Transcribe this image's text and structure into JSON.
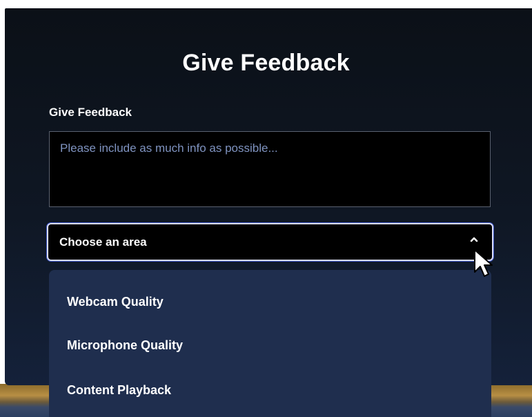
{
  "modal": {
    "title": "Give Feedback"
  },
  "feedback": {
    "label": "Give Feedback",
    "placeholder": "Please include as much info as possible..."
  },
  "area_select": {
    "selected": "Choose an area",
    "options": [
      {
        "label": "Webcam Quality"
      },
      {
        "label": "Microphone Quality"
      },
      {
        "label": "Content Playback"
      }
    ]
  },
  "colors": {
    "modal_bg": "#0b1017",
    "dropdown_bg": "#1f2e4e",
    "placeholder_text": "#7f93c0",
    "focus_ring": "#d9dcf5"
  },
  "icons": {
    "select_toggle": "chevron-up-icon",
    "pointer": "mouse-pointer-icon"
  }
}
